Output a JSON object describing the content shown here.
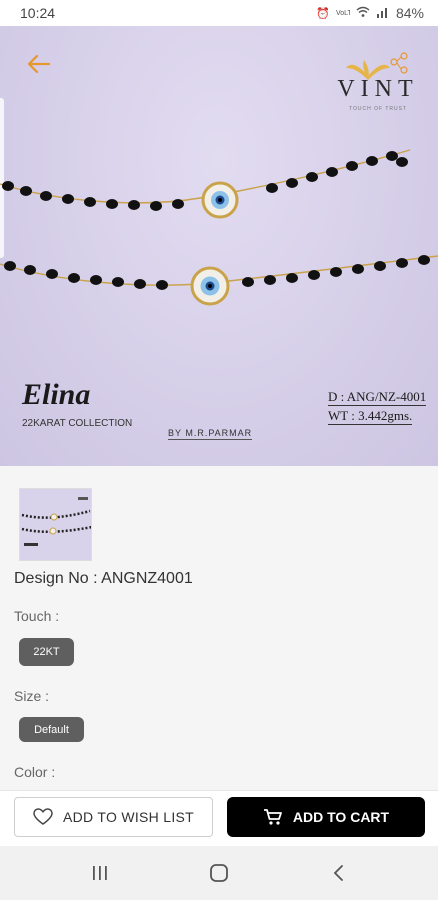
{
  "status_bar": {
    "time": "10:24",
    "icons": [
      "alarm-icon",
      "volte-icon",
      "wifi-icon",
      "signal-icon"
    ],
    "battery": "84%"
  },
  "hero": {
    "brand_name": "VINT",
    "brand_tagline": "TOUCH OF TRUST",
    "collection_title": "Elina",
    "collection_subtitle": "22KARAT COLLECTION",
    "byline": "BY M.R.PARMAR",
    "design_code": "D : ANG/NZ-4001",
    "weight": "WT : 3.442gms."
  },
  "product": {
    "design_no": "Design No : ANGNZ4001",
    "touch_label": "Touch :",
    "touch_value": "22KT",
    "size_label": "Size :",
    "size_value": "Default",
    "color_label": "Color :"
  },
  "actions": {
    "wishlist_label": "ADD TO WISH LIST",
    "cart_label": "ADD TO CART"
  },
  "colors": {
    "accent": "#e8962e",
    "hero_bg": "#d8d2ea",
    "chip_bg": "#5f5f5f",
    "cart_bg": "#000000"
  }
}
